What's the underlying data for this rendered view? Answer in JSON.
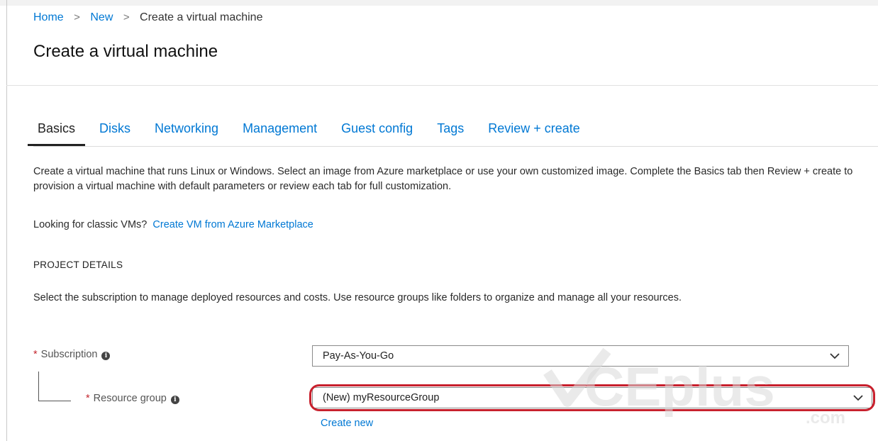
{
  "breadcrumb": {
    "items": [
      "Home",
      "New",
      "Create a virtual machine"
    ],
    "separator": ">"
  },
  "page": {
    "title": "Create a virtual machine"
  },
  "tabs": [
    {
      "label": "Basics",
      "active": true
    },
    {
      "label": "Disks",
      "active": false
    },
    {
      "label": "Networking",
      "active": false
    },
    {
      "label": "Management",
      "active": false
    },
    {
      "label": "Guest config",
      "active": false
    },
    {
      "label": "Tags",
      "active": false
    },
    {
      "label": "Review + create",
      "active": false
    }
  ],
  "intro": {
    "description": "Create a virtual machine that runs Linux or Windows. Select an image from Azure marketplace or use your own customized image. Complete the Basics tab then Review + create to provision a virtual machine with default parameters or review each tab for full customization.",
    "classic_prefix": "Looking for classic VMs?",
    "classic_link": "Create VM from Azure Marketplace"
  },
  "project_details": {
    "heading": "PROJECT DETAILS",
    "description": "Select the subscription to manage deployed resources and costs. Use resource groups like folders to organize and manage all your resources.",
    "subscription": {
      "required_mark": "*",
      "label": "Subscription",
      "value": "Pay-As-You-Go"
    },
    "resource_group": {
      "required_mark": "*",
      "label": "Resource group",
      "value": "(New) myResourceGroup",
      "create_new": "Create new"
    }
  },
  "icons": {
    "info": "i",
    "chevron": "chevron-down-icon"
  },
  "colors": {
    "link": "#0078d4",
    "required": "#c4262e",
    "highlight": "#c8202d"
  },
  "watermark": {
    "text": "CEplus",
    "suffix": ".com"
  }
}
